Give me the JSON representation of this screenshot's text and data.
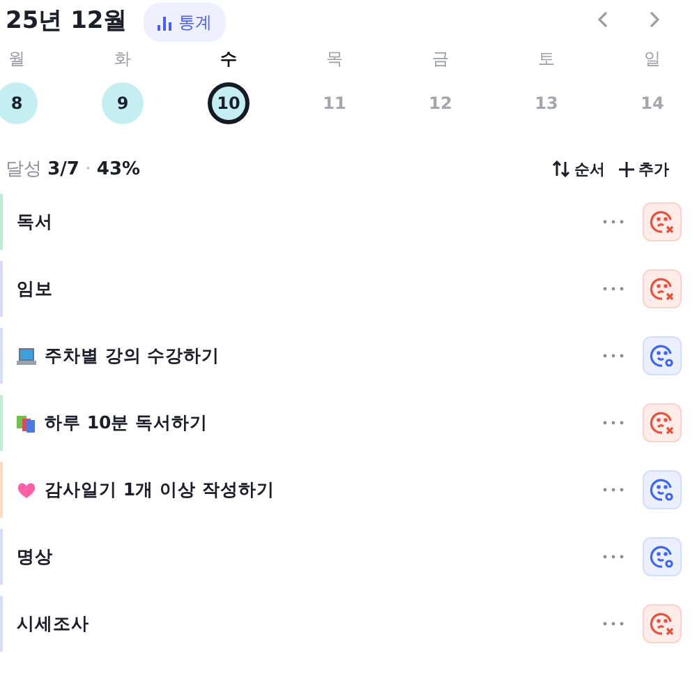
{
  "header": {
    "title": "25년 12월",
    "stats_button": "통계"
  },
  "week": [
    {
      "weekday": "월",
      "date": "8",
      "done": true,
      "selected": false,
      "future": false
    },
    {
      "weekday": "화",
      "date": "9",
      "done": true,
      "selected": false,
      "future": false
    },
    {
      "weekday": "수",
      "date": "10",
      "done": true,
      "selected": true,
      "future": false
    },
    {
      "weekday": "목",
      "date": "11",
      "done": false,
      "selected": false,
      "future": true
    },
    {
      "weekday": "금",
      "date": "12",
      "done": false,
      "selected": false,
      "future": true
    },
    {
      "weekday": "토",
      "date": "13",
      "done": false,
      "selected": false,
      "future": true
    },
    {
      "weekday": "일",
      "date": "14",
      "done": false,
      "selected": false,
      "future": true
    }
  ],
  "summary": {
    "label": "달성",
    "count": "3/7",
    "separator": "·",
    "percent": "43%"
  },
  "actions": {
    "sort": "순서",
    "add": "추가"
  },
  "habits": [
    {
      "name": "독서",
      "kind": "plain",
      "color": "#b9ecd2",
      "done": false
    },
    {
      "name": "임보",
      "kind": "plain",
      "color": "#d6dbf6",
      "done": false
    },
    {
      "name": "주차별 강의 수강하기",
      "kind": "laptop",
      "color": "#d6ddf7",
      "done": true
    },
    {
      "name": "하루 10분 독서하기",
      "kind": "books",
      "color": "#bfeed3",
      "done": false
    },
    {
      "name": "감사일기 1개 이상 작성하기",
      "kind": "heart",
      "color": "#fcdcc0",
      "done": true
    },
    {
      "name": "명상",
      "kind": "plain",
      "color": "#d6ddf7",
      "done": true
    },
    {
      "name": "시세조사",
      "kind": "plain",
      "color": "#d6ddf7",
      "done": false
    }
  ]
}
